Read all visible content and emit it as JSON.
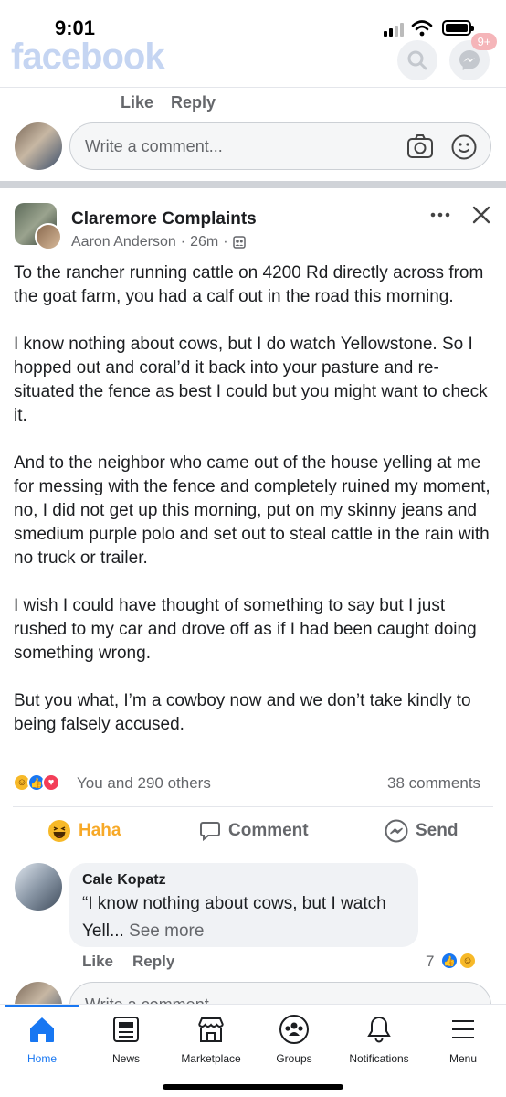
{
  "status_bar": {
    "time": "9:01"
  },
  "header": {
    "logo": "facebook",
    "messenger_badge": "9+",
    "icons": [
      "search-icon",
      "messenger-icon"
    ]
  },
  "previous_comment": {
    "like_label": "Like",
    "reply_label": "Reply"
  },
  "composer_top": {
    "placeholder": "Write a comment...",
    "icons": [
      "camera-icon",
      "emoji-icon"
    ]
  },
  "post": {
    "group_name": "Claremore Complaints",
    "author": "Aaron Anderson",
    "time": "26m",
    "meta_separator": "·",
    "paragraphs": [
      "To the rancher running cattle on 4200 Rd directly across from the goat farm, you had a calf out in the road this morning.",
      "I know nothing about cows, but I do watch Yellowstone. So I hopped out and coral’d it back into your pasture and re-situated the fence as best I could but you might want to check it.",
      "And to the neighbor who came out of the house yelling at me for messing with the fence and completely ruined my moment, no, I did not get up this morning, put on my skinny jeans and smedium purple polo and set out to steal cattle in the rain with no truck or trailer.",
      "I wish I could have thought of something to say but I just rushed to my car and drove off as if I had been caught doing something wrong.",
      "But you what, I’m a cowboy now and we don’t take kindly to being falsely accused."
    ],
    "reactions_text": "You and 290 others",
    "comments_count": "38 comments",
    "actions": {
      "haha": "Haha",
      "comment": "Comment",
      "send": "Send"
    }
  },
  "top_comment": {
    "author": "Cale Kopatz",
    "text": "“I know nothing about cows, but I watch",
    "text_cont": "Yell...",
    "see_more": "See more",
    "like_label": "Like",
    "reply_label": "Reply",
    "reaction_count": "7"
  },
  "composer_bottom": {
    "placeholder": "Write a comment..."
  },
  "tab_bar": {
    "home": "Home",
    "news": "News",
    "marketplace": "Marketplace",
    "groups": "Groups",
    "notifications": "Notifications",
    "menu": "Menu"
  },
  "colors": {
    "accent": "#1877f2",
    "haha": "#f7b928",
    "love": "#f33e58"
  }
}
